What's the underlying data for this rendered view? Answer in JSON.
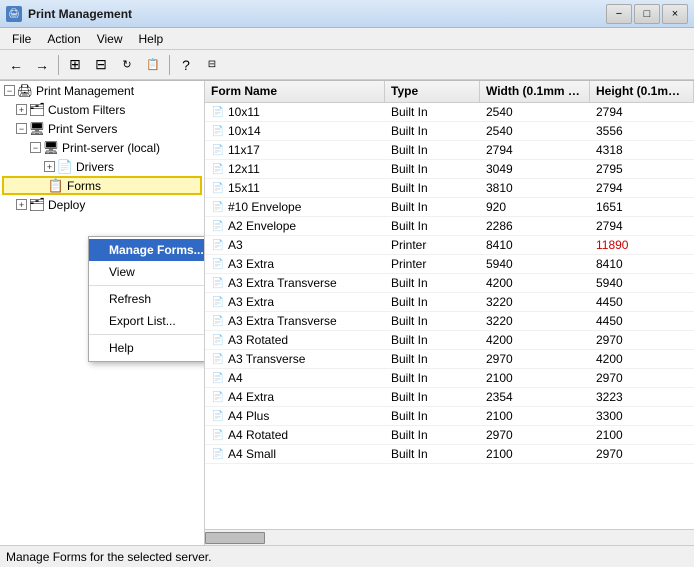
{
  "titleBar": {
    "title": "Print Management",
    "controls": [
      "−",
      "□",
      "×"
    ]
  },
  "menuBar": {
    "items": [
      "File",
      "Action",
      "View",
      "Help"
    ]
  },
  "toolbar": {
    "buttons": [
      "←",
      "→",
      "⊞",
      "⊟",
      "↻",
      "📋",
      "?",
      "🖥"
    ]
  },
  "tree": {
    "items": [
      {
        "label": "Print Management",
        "indent": 0,
        "expand": "−",
        "icon": "🖨",
        "selected": false
      },
      {
        "label": "Custom Filters",
        "indent": 1,
        "expand": "+",
        "icon": "📁",
        "selected": false
      },
      {
        "label": "Print Servers",
        "indent": 1,
        "expand": "−",
        "icon": "📁",
        "selected": false
      },
      {
        "label": "Print-server (local)",
        "indent": 2,
        "expand": "−",
        "icon": "🖥",
        "selected": false
      },
      {
        "label": "Drivers",
        "indent": 3,
        "expand": "+",
        "icon": "📁",
        "selected": false
      },
      {
        "label": "Forms",
        "indent": 3,
        "expand": null,
        "icon": "📄",
        "selected": false,
        "highlighted": true
      },
      {
        "label": "Deploy",
        "indent": 1,
        "expand": "+",
        "icon": "📁",
        "selected": false
      }
    ]
  },
  "contextMenu": {
    "items": [
      {
        "label": "Manage Forms...",
        "highlighted": true,
        "submenu": false
      },
      {
        "label": "View",
        "highlighted": false,
        "submenu": true
      },
      {
        "label": "Refresh",
        "highlighted": false,
        "submenu": false
      },
      {
        "label": "Export List...",
        "highlighted": false,
        "submenu": false
      },
      {
        "label": "Help",
        "highlighted": false,
        "submenu": false
      }
    ]
  },
  "table": {
    "columns": [
      "Form Name",
      "Type",
      "Width (0.1mm u...",
      "Height (0.1mm ..."
    ],
    "rows": [
      {
        "name": "10x11",
        "type": "Built In",
        "width": "2540",
        "height": "2794",
        "heightRed": false
      },
      {
        "name": "10x14",
        "type": "Built In",
        "width": "2540",
        "height": "3556",
        "heightRed": false
      },
      {
        "name": "11x17",
        "type": "Built In",
        "width": "2794",
        "height": "4318",
        "heightRed": false
      },
      {
        "name": "12x11",
        "type": "Built In",
        "width": "3049",
        "height": "2795",
        "heightRed": false
      },
      {
        "name": "15x11",
        "type": "Built In",
        "width": "3810",
        "height": "2794",
        "heightRed": false
      },
      {
        "name": "#10 Envelope",
        "type": "Built In",
        "width": "920",
        "height": "1651",
        "heightRed": false
      },
      {
        "name": "A2 Envelope",
        "type": "Built In",
        "width": "2286",
        "height": "2794",
        "heightRed": false
      },
      {
        "name": "A3",
        "type": "Printer",
        "width": "8410",
        "height": "11890",
        "heightRed": true
      },
      {
        "name": "A3 Extra",
        "type": "Printer",
        "width": "5940",
        "height": "8410",
        "heightRed": false
      },
      {
        "name": "A3 Extra Transverse",
        "type": "Built In",
        "width": "4200",
        "height": "5940",
        "heightRed": false
      },
      {
        "name": "A3 Extra",
        "type": "Built In",
        "width": "3220",
        "height": "4450",
        "heightRed": false
      },
      {
        "name": "A3 Extra Transverse",
        "type": "Built In",
        "width": "3220",
        "height": "4450",
        "heightRed": false
      },
      {
        "name": "A3 Rotated",
        "type": "Built In",
        "width": "4200",
        "height": "2970",
        "heightRed": false
      },
      {
        "name": "A3 Transverse",
        "type": "Built In",
        "width": "2970",
        "height": "4200",
        "heightRed": false
      },
      {
        "name": "A4",
        "type": "Built In",
        "width": "2100",
        "height": "2970",
        "heightRed": false
      },
      {
        "name": "A4 Extra",
        "type": "Built In",
        "width": "2354",
        "height": "3223",
        "heightRed": false
      },
      {
        "name": "A4 Plus",
        "type": "Built In",
        "width": "2100",
        "height": "3300",
        "heightRed": false
      },
      {
        "name": "A4 Rotated",
        "type": "Built In",
        "width": "2970",
        "height": "2100",
        "heightRed": false
      },
      {
        "name": "A4 Small",
        "type": "Built In",
        "width": "2100",
        "height": "2970",
        "heightRed": false
      }
    ]
  },
  "statusBar": {
    "text": "Manage Forms for the selected server."
  }
}
